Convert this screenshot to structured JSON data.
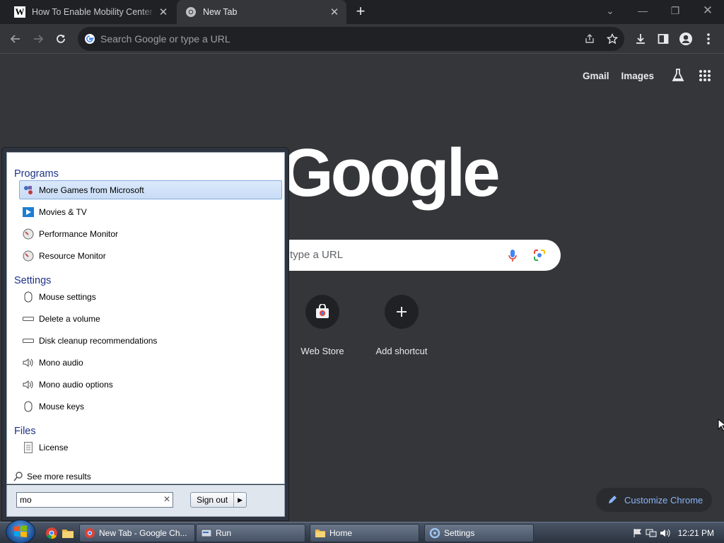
{
  "browser": {
    "tabs": [
      {
        "title": "How To Enable Mobility Center (",
        "favicon": "wikihow-favicon",
        "active": false
      },
      {
        "title": "New Tab",
        "favicon": "chrome-favicon",
        "active": true
      }
    ],
    "omnibox": {
      "placeholder": "Search Google or type a URL"
    }
  },
  "ntp": {
    "top_links": {
      "gmail": "Gmail",
      "images": "Images"
    },
    "logo": "Google",
    "search_placeholder": "type a URL",
    "shortcuts": [
      {
        "label": "Web Store",
        "icon": "web-store-icon"
      },
      {
        "label": "Add shortcut",
        "icon": "plus-icon"
      }
    ],
    "customize_label": "Customize Chrome"
  },
  "start_menu": {
    "sections": {
      "programs": "Programs",
      "settings": "Settings",
      "files": "Files"
    },
    "programs": [
      {
        "label": "More Games from Microsoft",
        "icon": "games-icon",
        "selected": true
      },
      {
        "label": "Movies & TV",
        "icon": "movies-icon"
      },
      {
        "label": "Performance Monitor",
        "icon": "monitor-icon"
      },
      {
        "label": "Resource Monitor",
        "icon": "monitor-icon"
      }
    ],
    "settings": [
      {
        "label": "Mouse settings",
        "icon": "mouse-icon"
      },
      {
        "label": "Delete a volume",
        "icon": "drive-icon"
      },
      {
        "label": "Disk cleanup recommendations",
        "icon": "drive-icon"
      },
      {
        "label": "Mono audio",
        "icon": "speaker-icon"
      },
      {
        "label": "Mono audio options",
        "icon": "speaker-icon"
      },
      {
        "label": "Mouse keys",
        "icon": "mouse-icon"
      }
    ],
    "files": [
      {
        "label": "License",
        "icon": "document-icon"
      }
    ],
    "see_more": "See more results",
    "search_value": "mo",
    "signout_label": "Sign out"
  },
  "taskbar": {
    "tasks": [
      {
        "label": "New Tab - Google Ch...",
        "icon": "chrome-icon"
      },
      {
        "label": "Run",
        "icon": "run-icon"
      },
      {
        "label": "Home",
        "icon": "folder-icon"
      },
      {
        "label": "Settings",
        "icon": "settings-icon"
      }
    ],
    "clock": "12:21 PM"
  },
  "colors": {
    "chrome_dark": "#202124",
    "chrome_surface": "#35363a",
    "link_blue": "#8ab4f8",
    "start_header": "#1e3287",
    "selection": "#c9dcf6"
  }
}
